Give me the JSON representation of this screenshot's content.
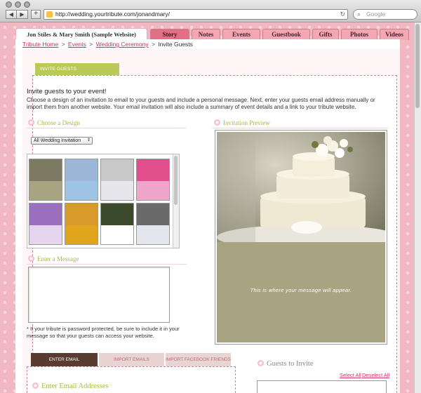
{
  "browser": {
    "url": "http://wedding.yourtribute.com/jonandmary/",
    "search_placeholder": "Google",
    "back_icon": "◀",
    "forward_icon": "▶",
    "plus_icon": "+",
    "reload_icon": "↻",
    "search_icon": "⌕"
  },
  "site": {
    "title": "Jon Stiles & Mary Smith (Sample Website)",
    "tabs": [
      {
        "label": "Story",
        "active": true
      },
      {
        "label": "Notes",
        "active": false
      },
      {
        "label": "Events",
        "active": false
      },
      {
        "label": "Guestbook",
        "active": false
      },
      {
        "label": "Gifts",
        "active": false
      },
      {
        "label": "Photos",
        "active": false
      },
      {
        "label": "Videos",
        "active": false
      }
    ]
  },
  "breadcrumb": {
    "home": "Tribute Home",
    "sep1": ">",
    "events": "Events",
    "sep2": ">",
    "ceremony": "Wedding Ceremony",
    "sep3": ">",
    "current": "Invite Guests"
  },
  "invite": {
    "header": "INVITE GUESTS",
    "title": "Invite guests to your event!",
    "description": "Choose a design of an invitation to email to your guests and include a personal message. Next, enter your guests email address manually or import them from another website. Your email invitation will also include a summary of event details and a link to your tribute website."
  },
  "design": {
    "heading": "Choose a Design",
    "select_value": "All Wedding Invitation",
    "select_arrow": "⇕",
    "thumbnails": [
      {
        "name": "cake",
        "img_color": "#7d7a63",
        "band_color": "#a8a481"
      },
      {
        "name": "chapel",
        "img_color": "#9cb7d8",
        "band_color": "#9ec3e4"
      },
      {
        "name": "reception",
        "img_color": "#c9c9c9",
        "band_color": "#e6e6ec"
      },
      {
        "name": "roses",
        "img_color": "#e24e8c",
        "band_color": "#f0a6cc"
      },
      {
        "name": "gifts",
        "img_color": "#9b6fc0",
        "band_color": "#e4d4ee"
      },
      {
        "name": "flowers",
        "img_color": "#d89a2a",
        "band_color": "#e1a51c"
      },
      {
        "name": "bouquet",
        "img_color": "#3a4a2a",
        "band_color": "#ffffff"
      },
      {
        "name": "hands",
        "img_color": "#6a6a6a",
        "band_color": "#e5e5ee"
      }
    ]
  },
  "message": {
    "heading": "Enter a Message",
    "note": "* If your tribute is password protected, be sure to include it in your message so that your guests can access your website."
  },
  "preview": {
    "heading": "Invitation Preview",
    "message_placeholder": "This is where your message will appear."
  },
  "email_tabs": [
    {
      "label": "ENTER EMAIL",
      "active": true
    },
    {
      "label": "IMPORT EMAILS",
      "active": false
    },
    {
      "label": "IMPORT FACEBOOK FRIENDS",
      "active": false
    }
  ],
  "email_section": {
    "heading": "Enter Email Addresses"
  },
  "guests": {
    "heading": "Guests to Invite",
    "select_all": "Select All",
    "deselect_all": "Deselect All"
  },
  "colors": {
    "accent_pink": "#e36f85",
    "link": "#cc3366",
    "green": "#b9c95a",
    "background": "#f1b7c3"
  }
}
